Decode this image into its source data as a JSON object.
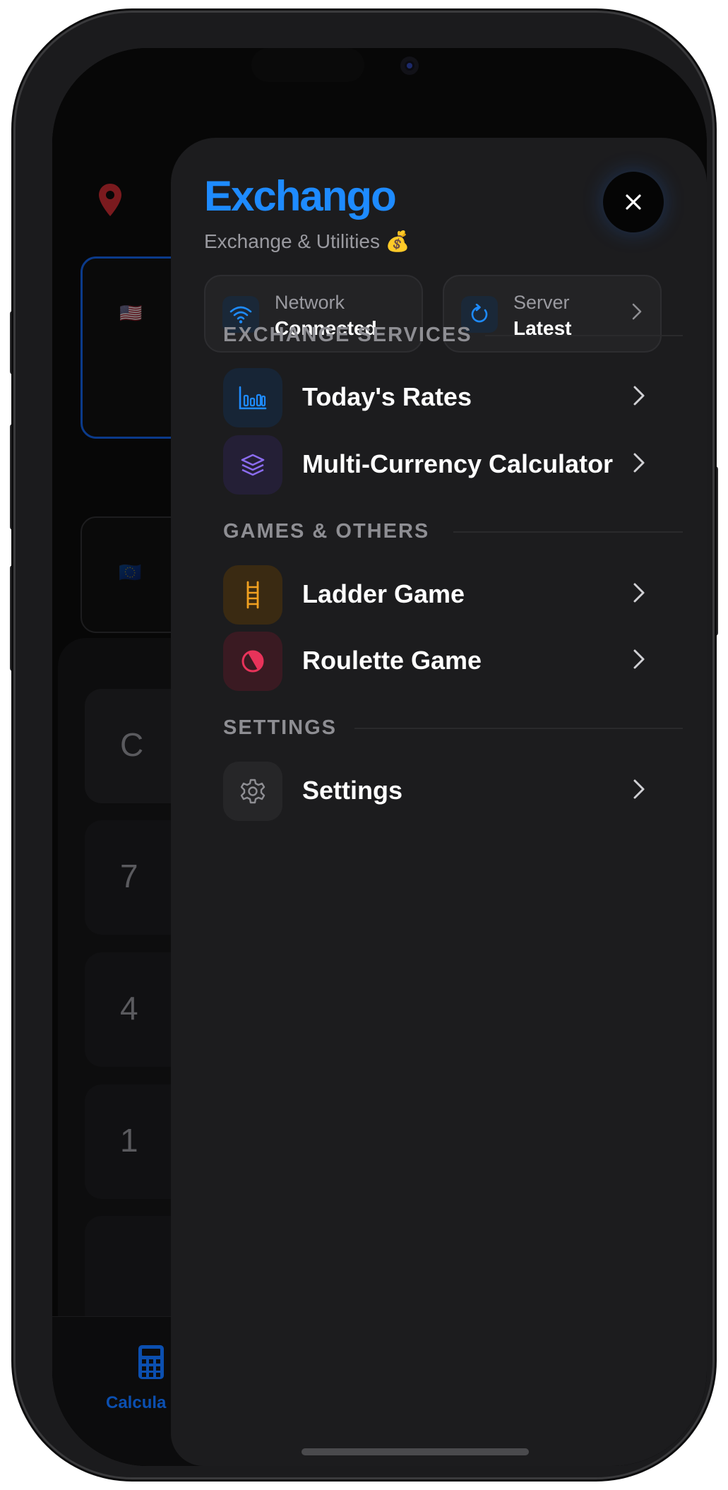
{
  "background_app": {
    "keys": [
      "C",
      "7",
      "4",
      "1",
      ""
    ],
    "tab_label": "Calcula"
  },
  "drawer": {
    "brand": "Exchango",
    "tagline": "Exchange & Utilities 💰",
    "status": {
      "network": {
        "title": "Network",
        "value": "Connected"
      },
      "server": {
        "title": "Server",
        "value": "Latest"
      }
    },
    "sections": {
      "exchange": {
        "title": "EXCHANGE SERVICES",
        "items": [
          "Today's Rates",
          "Multi-Currency Calculator"
        ]
      },
      "games": {
        "title": "GAMES & OTHERS",
        "items": [
          "Ladder Game",
          "Roulette Game"
        ]
      },
      "settings": {
        "title": "SETTINGS",
        "items": [
          "Settings"
        ]
      }
    }
  },
  "colors": {
    "brand": "#1e8bff",
    "drawer_bg": "#1c1c1e",
    "rates_icon": "#1e8bff",
    "calculator_icon": "#8b6cf0",
    "ladder_icon": "#f0a020",
    "roulette_icon": "#e8335a",
    "settings_icon": "#8e8e93",
    "location_pin": "#c0262d"
  }
}
